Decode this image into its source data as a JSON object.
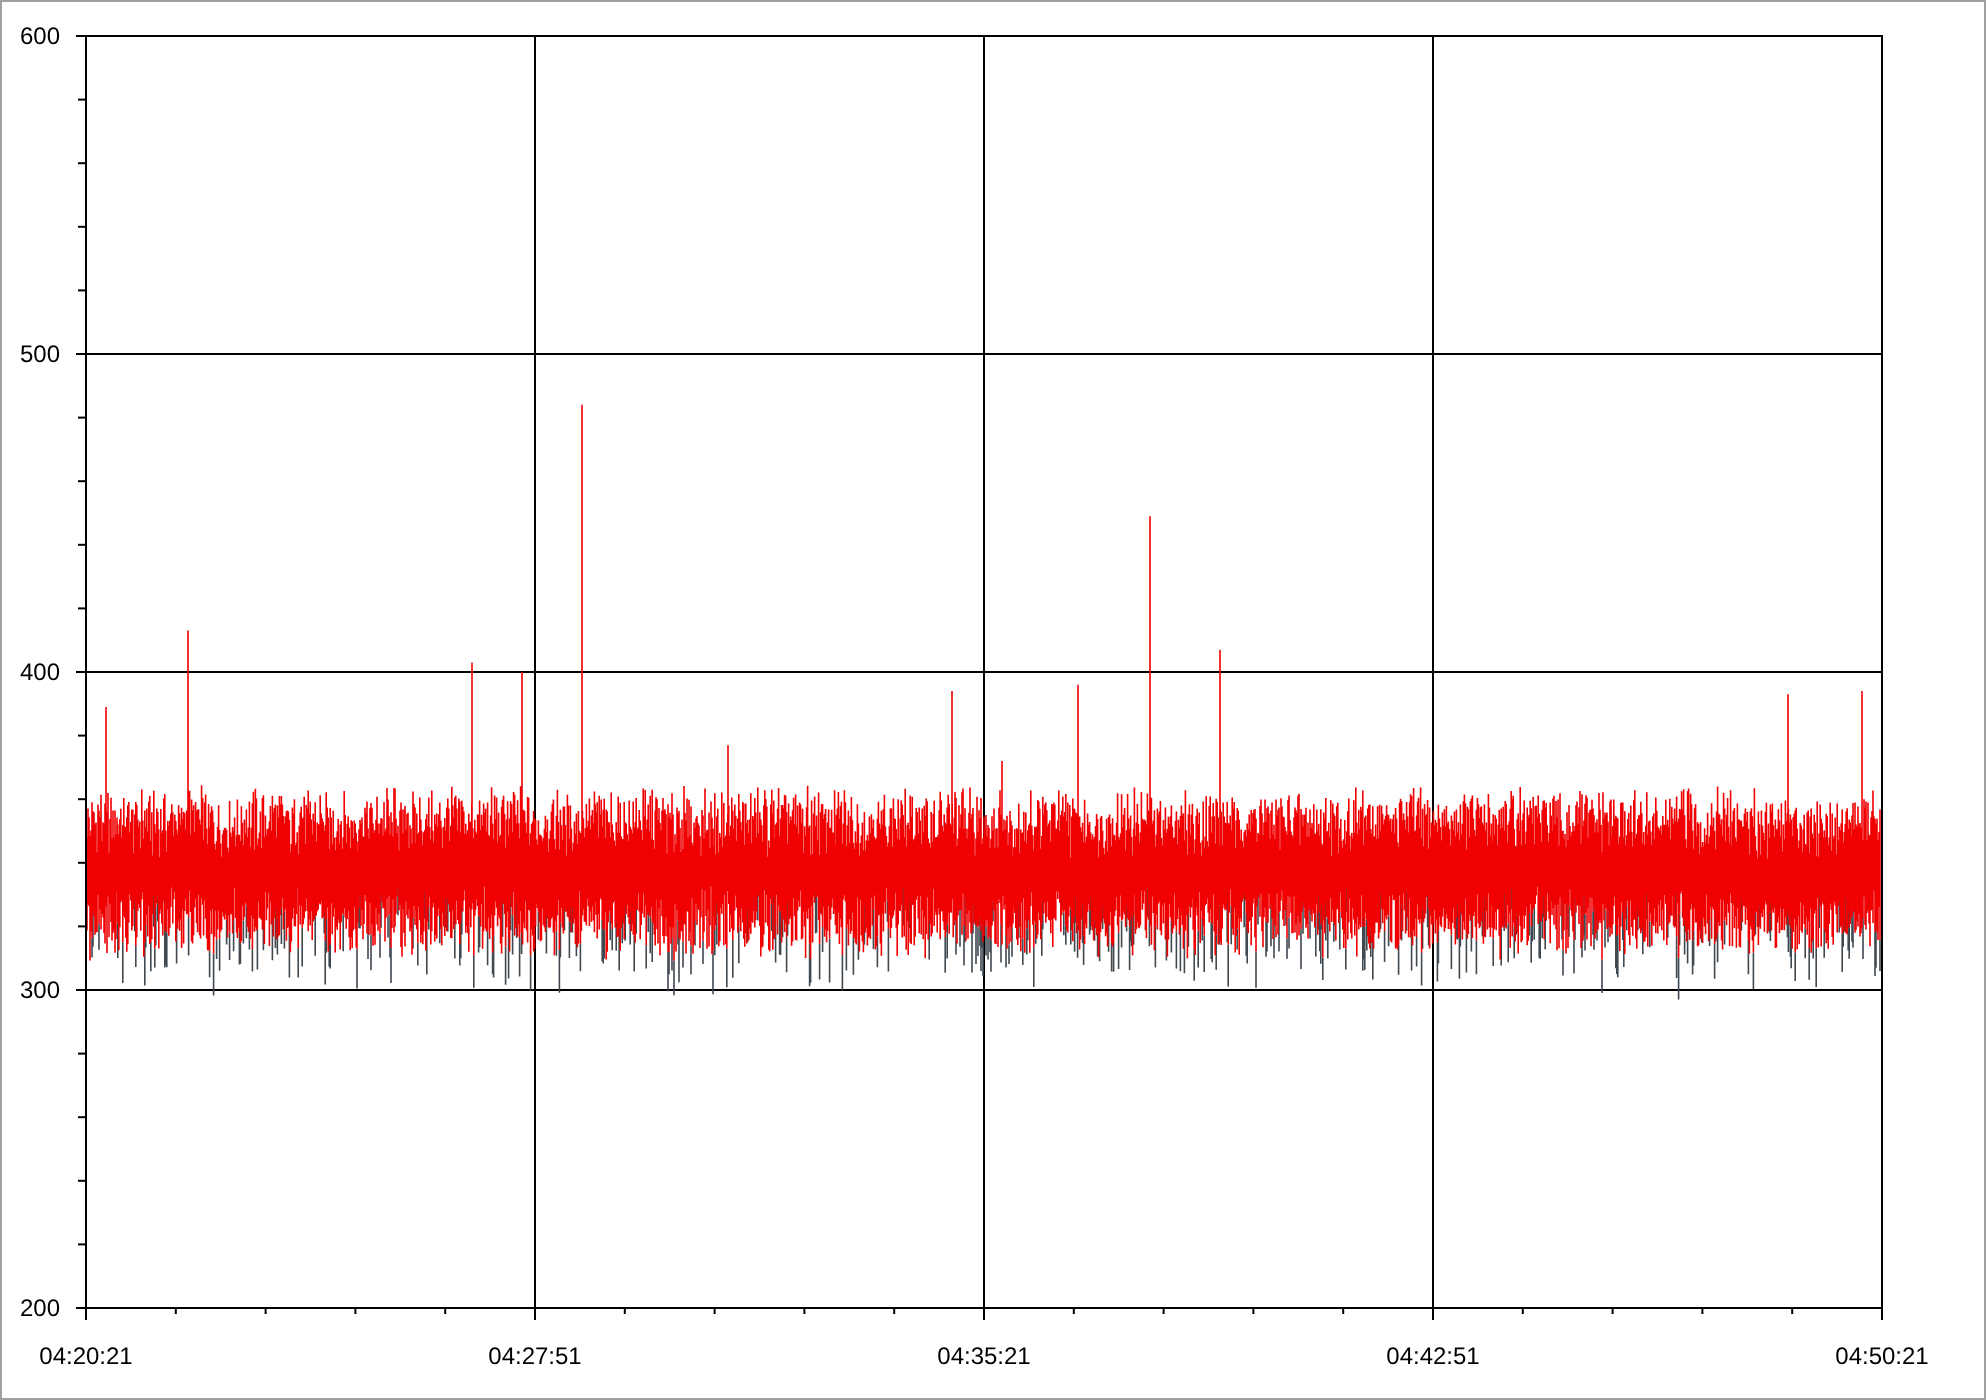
{
  "chart": {
    "yticks": [
      "600",
      "500",
      "400",
      "300",
      "200"
    ],
    "xticks": [
      "04:20:21",
      "04:27:51",
      "04:35:21",
      "04:42:51",
      "04:50:21"
    ]
  }
}
